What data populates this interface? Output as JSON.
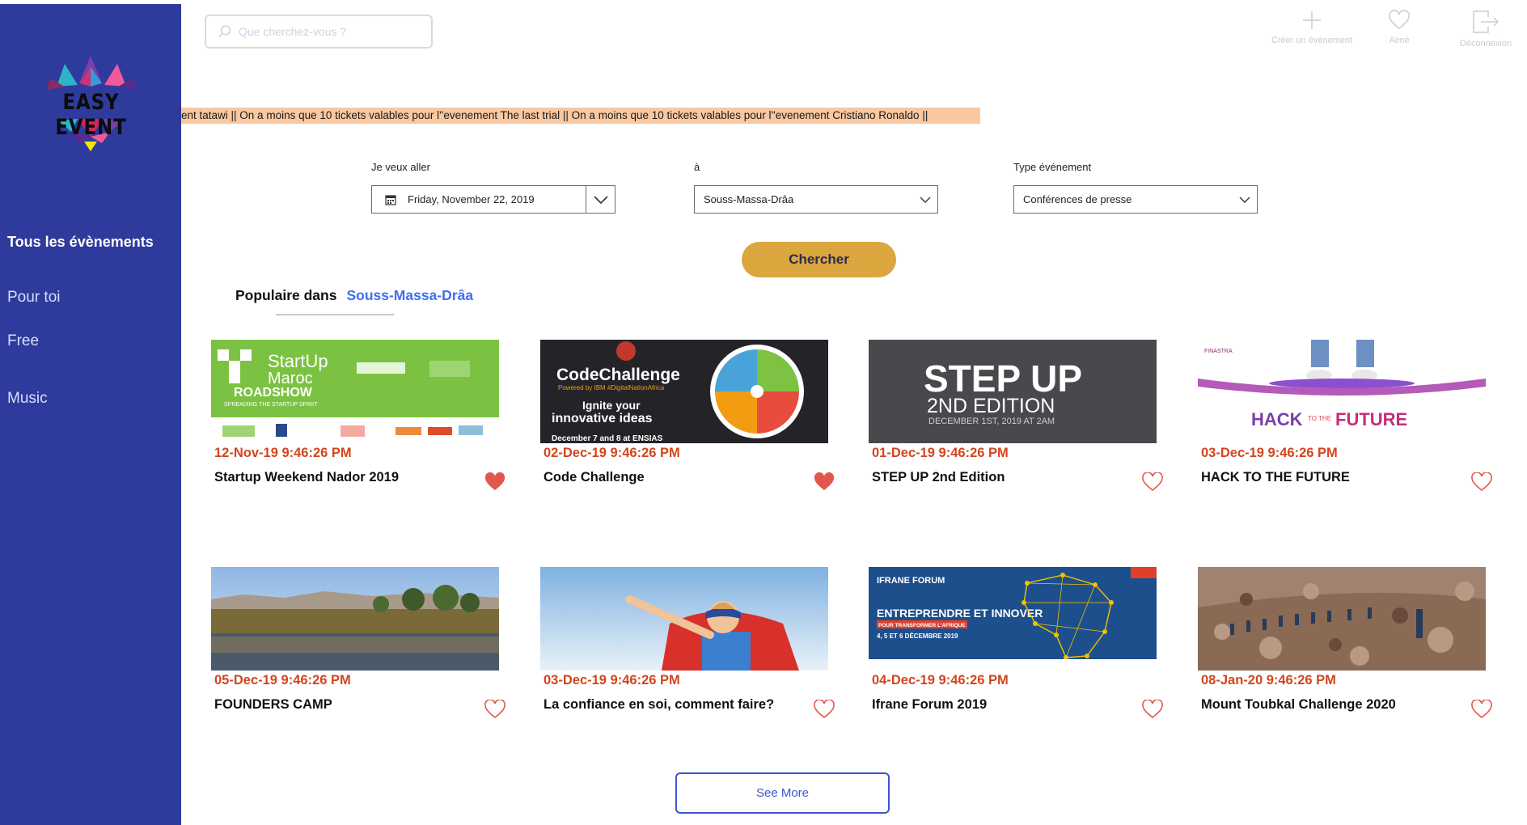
{
  "app": {
    "logo_text": "EASY EVENT"
  },
  "sidebar": {
    "items": [
      {
        "label": "Tous les évènements",
        "active": true
      },
      {
        "label": "Pour toi"
      },
      {
        "label": "Free"
      },
      {
        "label": "Music"
      }
    ]
  },
  "search": {
    "placeholder": "Que cherchez-vous ?"
  },
  "top_actions": {
    "create_label": "Créer un évènement",
    "liked_label": "Aimé",
    "logout_label": "Déconnexion"
  },
  "ticker": {
    "text": "ent tatawi || On a moins que 10 tickets valables pour l''evenement The last trial || On a moins que 10 tickets valables pour l''evenement Cristiano Ronaldo ||"
  },
  "filters": {
    "date_label": "Je veux aller",
    "date_value": "Friday, November 22, 2019",
    "location_label": "à",
    "location_value": "Souss-Massa-Drâa",
    "type_label": "Type événement",
    "type_value": "Conférences de presse"
  },
  "search_button": "Chercher",
  "popular": {
    "prefix": "Populaire dans",
    "region": "Souss-Massa-Drâa"
  },
  "events": [
    {
      "date": "12-Nov-19 9:46:26 PM",
      "title": "Startup Weekend Nador 2019",
      "liked": true,
      "thumb_lines": [
        "StartUp",
        "Maroc",
        "ROADSHOW",
        "SPREADING THE STARTUP SPIRIT"
      ]
    },
    {
      "date": "02-Dec-19 9:46:26 PM",
      "title": "Code Challenge",
      "liked": true,
      "thumb_lines": [
        "CodeChallenge",
        "Powered by IBM #DigitalNationAfrica",
        "Ignite your",
        "innovative ideas",
        "December 7 and 8 at ENSIAS"
      ]
    },
    {
      "date": "01-Dec-19 9:46:26 PM",
      "title": "STEP UP 2nd Edition",
      "liked": false,
      "thumb_lines": [
        "STEP UP",
        "2ND EDITION",
        "DECEMBER 1ST, 2019 AT 2AM"
      ]
    },
    {
      "date": "03-Dec-19 9:46:26 PM",
      "title": "HACK TO THE FUTURE",
      "liked": false,
      "thumb_lines": [
        "FINASTRA",
        "HACK",
        "TO THE",
        "FUTURE"
      ]
    },
    {
      "date": "05-Dec-19 9:46:26 PM",
      "title": "FOUNDERS CAMP",
      "liked": false,
      "thumb_lines": []
    },
    {
      "date": "03-Dec-19 9:46:26 PM",
      "title": "La confiance en soi, comment faire?",
      "liked": false,
      "thumb_lines": []
    },
    {
      "date": "04-Dec-19 9:46:26 PM",
      "title": "Ifrane Forum 2019",
      "liked": false,
      "thumb_lines": [
        "IFRANE FORUM",
        "ENTREPRENDRE ET INNOVER",
        "POUR TRANSFORMER L'AFRIQUE",
        "4, 5 ET 6 DÉCEMBRE 2019"
      ]
    },
    {
      "date": "08-Jan-20 9:46:26 PM",
      "title": "Mount Toubkal Challenge 2020",
      "liked": false,
      "thumb_lines": []
    }
  ],
  "see_more": "See More",
  "colors": {
    "sidebar": "#2f3b9c",
    "accent_button": "#dca63f",
    "date_text": "#d2451e",
    "heart": "#e2574c",
    "link": "#3f6ff0"
  }
}
